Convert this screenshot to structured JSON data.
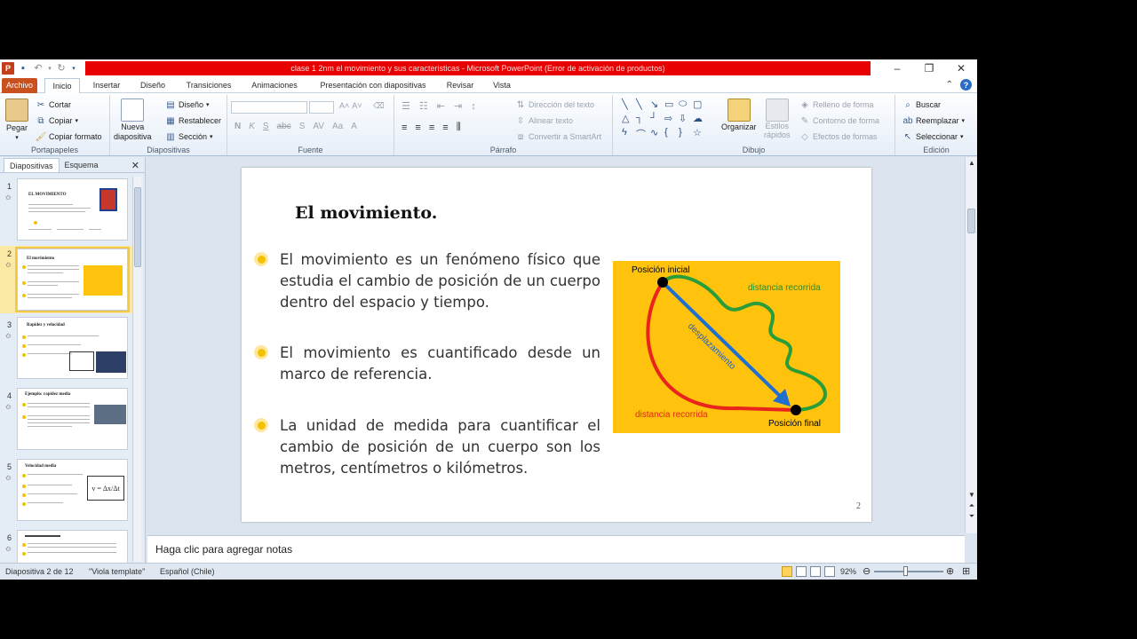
{
  "app": {
    "window_title": "clase 1 2nm el movimiento y sus caracteristicas  -  Microsoft PowerPoint (Error de activación de productos)"
  },
  "ribbon_tabs": [
    "Archivo",
    "Inicio",
    "Insertar",
    "Diseño",
    "Transiciones",
    "Animaciones",
    "Presentación con diapositivas",
    "Revisar",
    "Vista"
  ],
  "ribbon": {
    "portapapeles": {
      "label": "Portapapeles",
      "paste": "Pegar",
      "cut": "Cortar",
      "copy": "Copiar",
      "format": "Copiar formato"
    },
    "diapositivas": {
      "label": "Diapositivas",
      "new_slide_1": "Nueva",
      "new_slide_2": "diapositiva",
      "layout": "Diseño",
      "reset": "Restablecer",
      "section": "Sección"
    },
    "fuente": {
      "label": "Fuente"
    },
    "parrafo": {
      "label": "Párrafo",
      "text_direction": "Dirección del texto",
      "align_text": "Alinear texto",
      "smartart": "Convertir a SmartArt"
    },
    "dibujo": {
      "label": "Dibujo",
      "arrange": "Organizar",
      "styles_1": "Estilos",
      "styles_2": "rápidos",
      "fill": "Relleno de forma",
      "outline": "Contorno de forma",
      "effects": "Efectos de formas"
    },
    "edicion": {
      "label": "Edición",
      "find": "Buscar",
      "replace": "Reemplazar",
      "select": "Seleccionar"
    }
  },
  "panel": {
    "tab_slides": "Diapositivas",
    "tab_outline": "Esquema",
    "thumbnails": [
      {
        "num": "1",
        "title": "EL MOVIMIENTO"
      },
      {
        "num": "2",
        "title": "El movimiento"
      },
      {
        "num": "3",
        "title": "Rapidez y velocidad"
      },
      {
        "num": "4",
        "title": "Ejemplo: rapidez media"
      },
      {
        "num": "5",
        "title": "Velocidad media"
      },
      {
        "num": "6",
        "title": ""
      }
    ]
  },
  "slide": {
    "title": "El movimiento.",
    "bullets": [
      "El movimiento es un fenómeno físico que estudia el cambio de posición de un cuerpo dentro del espacio y tiempo.",
      "El movimiento es cuantificado desde un marco de referencia.",
      "La unidad de medida para cuantificar el cambio de posición de un cuerpo son los metros, centímetros o kilómetros."
    ],
    "page_number": "2",
    "diagram": {
      "start_label": "Posición inicial",
      "end_label": "Posición final",
      "green_label": "distancia recorrida",
      "red_label": "distancia recorrida",
      "arrow_label": "desplazamiento",
      "bg_color": "#ffc20d"
    }
  },
  "notes": {
    "placeholder": "Haga clic para agregar notas"
  },
  "status": {
    "slide_info": "Diapositiva 2 de 12",
    "template": "\"Viola template\"",
    "language": "Español (Chile)",
    "zoom": "92%"
  }
}
